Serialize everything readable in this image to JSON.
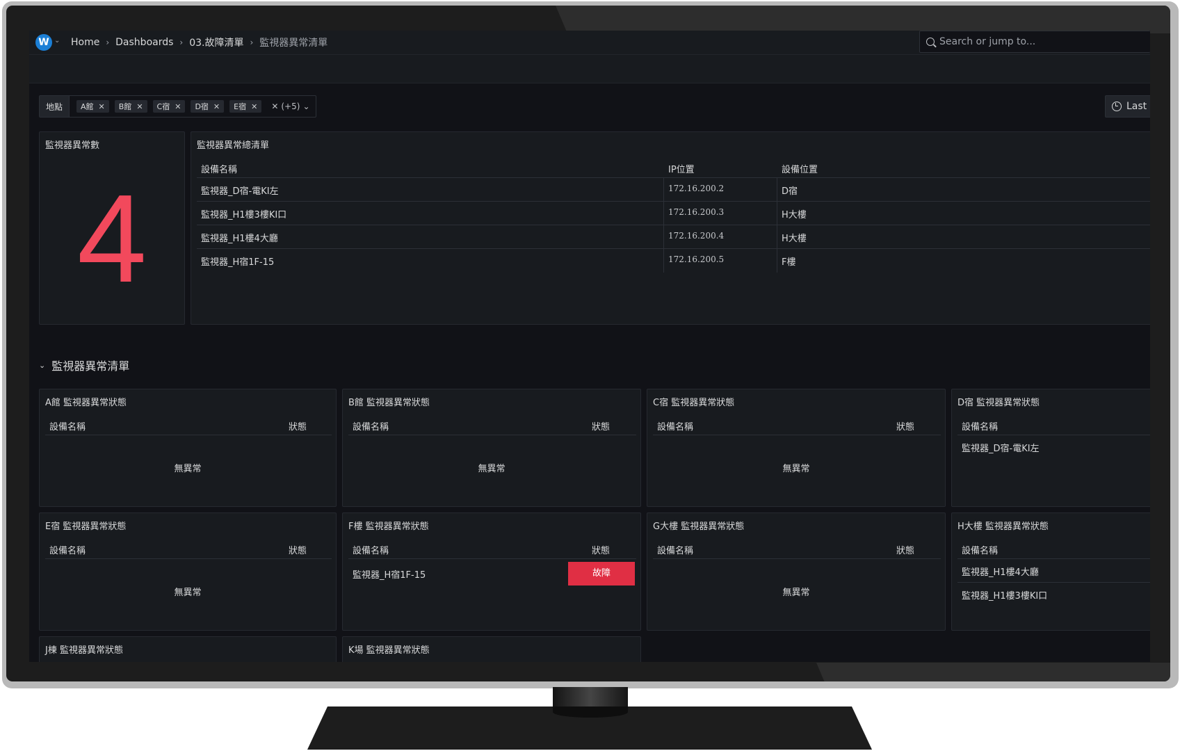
{
  "topbar": {
    "logo_letter": "W",
    "breadcrumbs": [
      "Home",
      "Dashboards",
      "03.故障清單",
      "監視器異常清單"
    ],
    "search_placeholder": "Search or jump to..."
  },
  "variables": {
    "label": "地點",
    "chips": [
      "A館",
      "B館",
      "C宿",
      "D宿",
      "E宿"
    ],
    "more": "(+5)",
    "time_label": "Last"
  },
  "stat": {
    "title": "監視器異常數",
    "value": "4"
  },
  "summary": {
    "title": "監視器異常總清單",
    "columns": [
      "設備名稱",
      "IP位置",
      "設備位置"
    ],
    "rows": [
      [
        "監視器_D宿-電KI左",
        "172.16.200.2",
        "D宿"
      ],
      [
        "監視器_H1樓3樓KI口",
        "172.16.200.3",
        "H大樓"
      ],
      [
        "監視器_H1樓4大廳",
        "172.16.200.4",
        "H大樓"
      ],
      [
        "監視器_H宿1F-15",
        "172.16.200.5",
        "F樓"
      ]
    ]
  },
  "row_title": "監視器異常清單",
  "col_device": "設備名稱",
  "col_status": "狀態",
  "empty_text": "無異常",
  "fault_text": "故障",
  "panels": [
    {
      "title": "A館 監視器異常狀態",
      "rows": []
    },
    {
      "title": "B館 監視器異常狀態",
      "rows": []
    },
    {
      "title": "C宿 監視器異常狀態",
      "rows": []
    },
    {
      "title": "D宿 監視器異常狀態",
      "rows": [
        "監視器_D宿-電KI左"
      ]
    },
    {
      "title": "E宿 監視器異常狀態",
      "rows": []
    },
    {
      "title": "F樓 監視器異常狀態",
      "rows": [
        "監視器_H宿1F-15"
      ]
    },
    {
      "title": "G大樓 監視器異常狀態",
      "rows": []
    },
    {
      "title": "H大樓 監視器異常狀態",
      "rows": [
        "監視器_H1樓4大廳",
        "監視器_H1樓3樓KI口"
      ]
    },
    {
      "title": "J棟 監視器異常狀態",
      "rows": []
    },
    {
      "title": "K場 監視器異常狀態",
      "rows": []
    }
  ],
  "colors": {
    "accent_red": "#f2495c",
    "fault_red": "#e02f44",
    "background": "#111217",
    "panel": "#181b1f"
  }
}
